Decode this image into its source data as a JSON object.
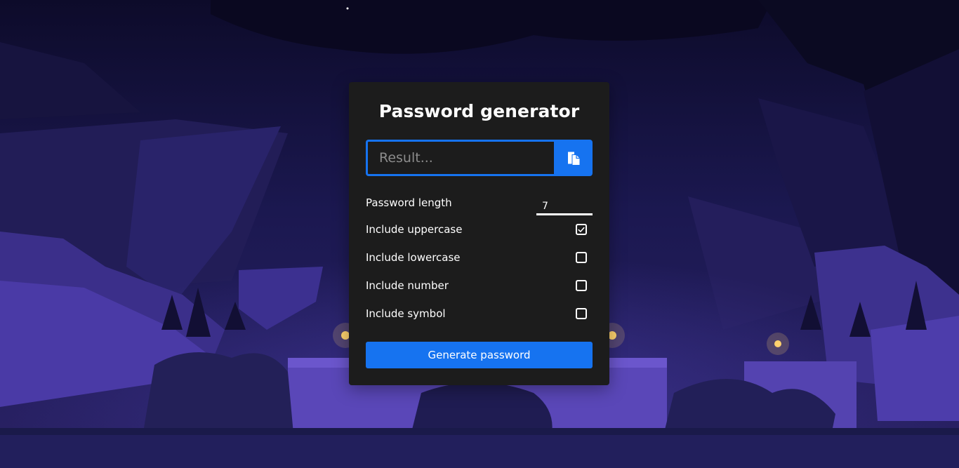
{
  "theme": {
    "accent": "#1673f0",
    "card_bg": "#1c1c1c",
    "text": "#ffffff"
  },
  "card": {
    "title": "Password generator"
  },
  "result": {
    "placeholder": "Result...",
    "value": "",
    "copy_icon": "clipboard-icon"
  },
  "options": {
    "length": {
      "label": "Password length",
      "value": "7"
    },
    "uppercase": {
      "label": "Include uppercase",
      "checked": true
    },
    "lowercase": {
      "label": "Include lowercase",
      "checked": false
    },
    "number": {
      "label": "Include number",
      "checked": false
    },
    "symbol": {
      "label": "Include symbol",
      "checked": false
    }
  },
  "generate": {
    "label": "Generate password"
  }
}
